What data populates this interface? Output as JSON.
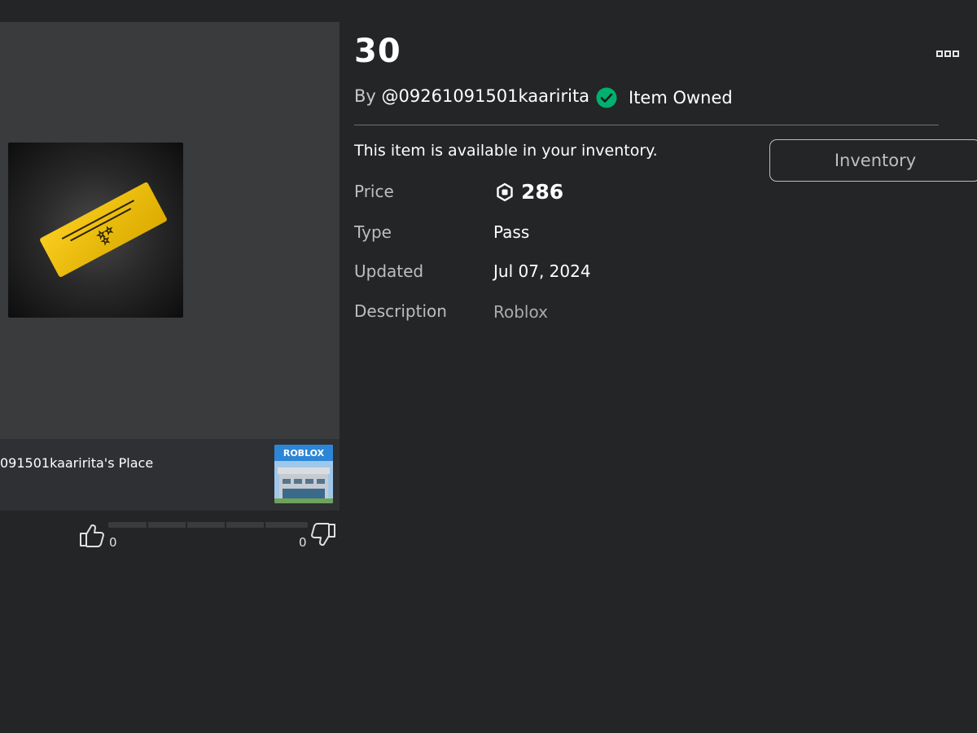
{
  "item": {
    "title": "30",
    "by_prefix": "By ",
    "creator": "@09261091501kaaririta",
    "owned_label": "Item Owned",
    "availability_message": "This item is available in your inventory.",
    "inventory_button": "Inventory"
  },
  "details": {
    "price_label": "Price",
    "price_value": "286",
    "type_label": "Type",
    "type_value": "Pass",
    "updated_label": "Updated",
    "updated_value": "Jul 07, 2024",
    "description_label": "Description",
    "description_value": "Roblox"
  },
  "place": {
    "name": "091501kaaririta's Place",
    "thumbnail_text": "ROBLOX"
  },
  "votes": {
    "up_count": "0",
    "down_count": "0"
  },
  "icons": {
    "more": "more-options-icon",
    "owned": "check-circle-icon",
    "currency": "robux-icon",
    "thumbs_up": "thumbs-up-icon",
    "thumbs_down": "thumbs-down-icon"
  },
  "colors": {
    "background": "#232527",
    "panel": "#393b3d",
    "owned_green": "#00b06f",
    "pass_gold": "#f2c200"
  }
}
